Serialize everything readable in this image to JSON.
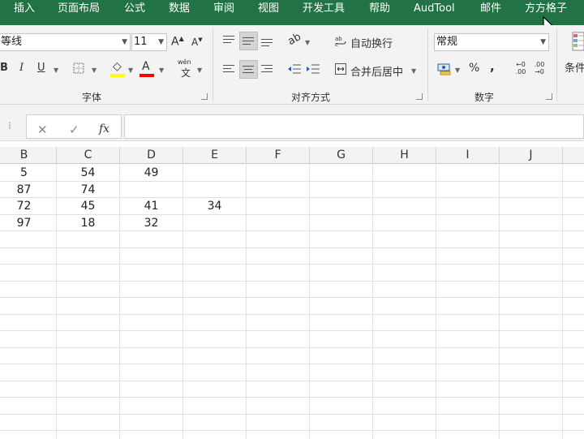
{
  "menu_tabs": [
    "插入",
    "页面布局",
    "公式",
    "数据",
    "审阅",
    "视图",
    "开发工具",
    "帮助",
    "AudTool",
    "邮件",
    "方方格子"
  ],
  "font": {
    "name": "等线",
    "size": "11",
    "grow_label": "A",
    "shrink_label": "A",
    "bold_label": "B",
    "italic_label": "I",
    "underline_label": "U",
    "fill_label": "◇",
    "color_label": "A",
    "wen_label": "wén",
    "wen_sub_label": "文",
    "group_label": "字体"
  },
  "alignment": {
    "orientation_label": "ab",
    "wrap_label": "自动换行",
    "merge_label": "合并后居中",
    "group_label": "对齐方式"
  },
  "number": {
    "format": "常规",
    "percent_label": "%",
    "comma_label": ",",
    "increase_decimal_label": "←0 .00",
    "decrease_decimal_label": ".00 →0",
    "group_label": "数字"
  },
  "styles": {
    "conditional_label": "条件"
  },
  "formula_bar": {
    "cancel_label": "✕",
    "enter_label": "✓",
    "fx_label": "fx",
    "value": ""
  },
  "columns": [
    "B",
    "C",
    "D",
    "E",
    "F",
    "G",
    "H",
    "I",
    "J"
  ],
  "rows": [
    [
      "5",
      "54",
      "49",
      "",
      "",
      "",
      "",
      "",
      ""
    ],
    [
      "87",
      "74",
      "",
      "",
      "",
      "",
      "",
      "",
      ""
    ],
    [
      "72",
      "45",
      "41",
      "34",
      "",
      "",
      "",
      "",
      ""
    ],
    [
      "97",
      "18",
      "32",
      "",
      "",
      "",
      "",
      "",
      ""
    ]
  ],
  "colors": {
    "ribbon_tab_bar": "#217346",
    "highlight_yellow": "#ffff00",
    "font_red": "#ff0000"
  }
}
